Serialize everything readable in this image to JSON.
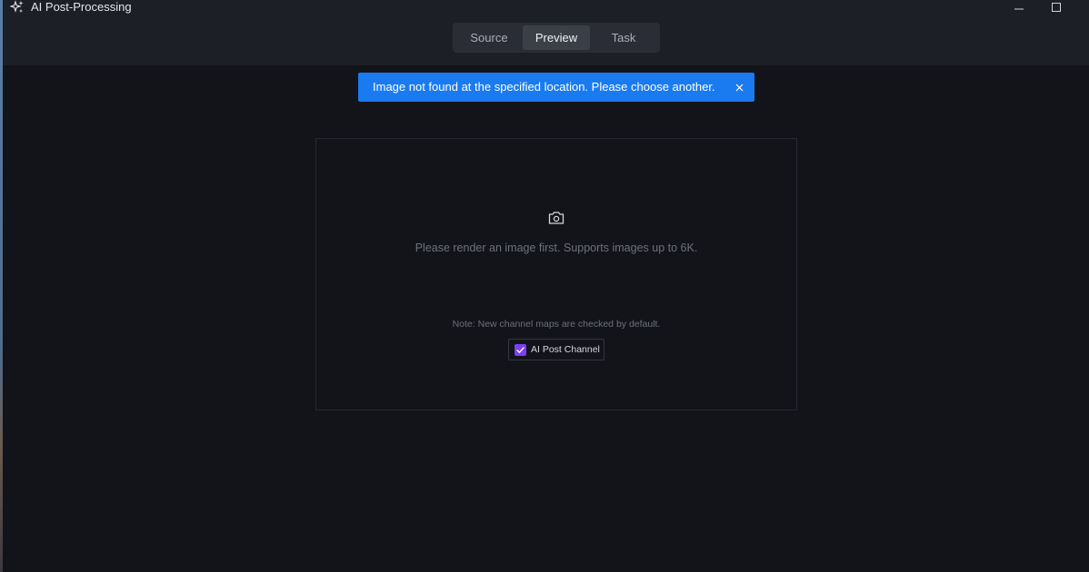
{
  "window": {
    "title": "AI Post-Processing"
  },
  "tabs": [
    {
      "label": "Source",
      "active": false
    },
    {
      "label": "Preview",
      "active": true
    },
    {
      "label": "Task",
      "active": false
    }
  ],
  "toast": {
    "message": "Image not found at the specified location. Please choose another.",
    "color": "#1a7bf0"
  },
  "panel": {
    "icon": "camera-icon",
    "message": "Please render an image first. Supports images up to 6K.",
    "note": "Note: New channel maps are checked by default.",
    "channel": {
      "label": "AI Post Channel",
      "checked": true,
      "accent": "#7b3ff2"
    }
  }
}
